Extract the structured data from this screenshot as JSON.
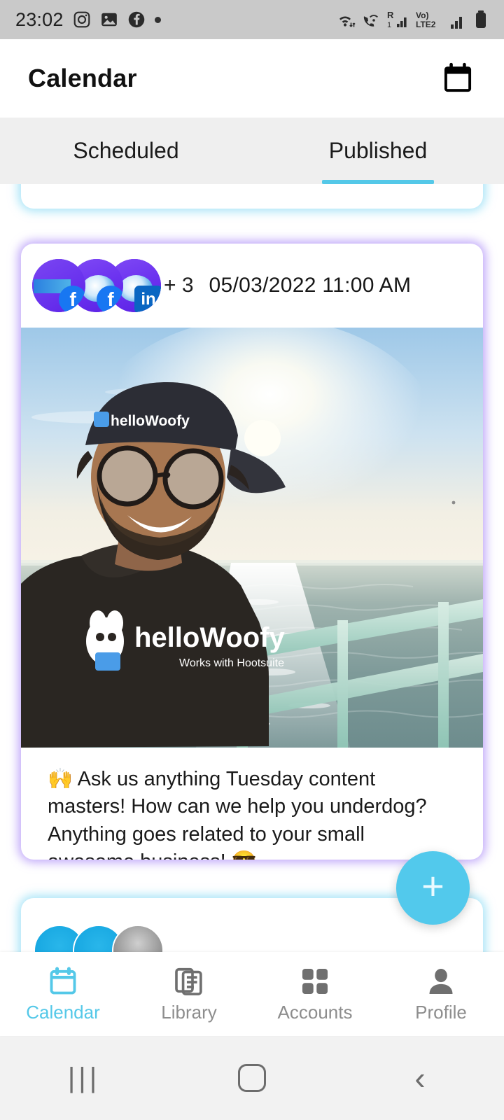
{
  "statusbar": {
    "time": "23:02",
    "left_icons": [
      "instagram-icon",
      "gallery-icon",
      "facebook-icon",
      "dot-icon"
    ],
    "right_icons": [
      "wifi-icon",
      "call-wifi-icon",
      "roaming-signal-icon",
      "volte-lte2-icon",
      "signal-icon",
      "battery-icon"
    ],
    "roaming_label": "R",
    "sim1_label": "1",
    "volte_label": "Vo)",
    "lte_label": "LTE2"
  },
  "appbar": {
    "title": "Calendar",
    "calendar_icon": "calendar-icon"
  },
  "tabs": [
    {
      "label": "Scheduled",
      "active": false
    },
    {
      "label": "Published",
      "active": true
    }
  ],
  "feed": {
    "top_partial_card": {
      "glow": "#60cef0"
    },
    "post": {
      "glow": "#966ef5",
      "date": "05/03/2022 11:00 AM",
      "extra_accounts": "+ 3",
      "accounts": [
        {
          "name": "content-avatar",
          "network": "facebook",
          "badge": "f"
        },
        {
          "name": "woofy-avatar",
          "network": "facebook",
          "badge": "f"
        },
        {
          "name": "woofy-avatar-2",
          "network": "linkedin",
          "badge": "in"
        }
      ],
      "image_alt": "selfie-on-pier-at-sunset",
      "text": "🙌 Ask us anything Tuesday content masters! How can we help you underdog? Anything goes related to your small awesome business! 😎"
    },
    "bottom_partial_card": {
      "glow": "#60cef0"
    }
  },
  "fab": {
    "label": "+",
    "name": "create-post-button",
    "color": "#52c9ec"
  },
  "bottomnav": [
    {
      "label": "Calendar",
      "icon": "calendar-icon",
      "active": true
    },
    {
      "label": "Library",
      "icon": "library-icon",
      "active": false
    },
    {
      "label": "Accounts",
      "icon": "grid-icon",
      "active": false
    },
    {
      "label": "Profile",
      "icon": "person-icon",
      "active": false
    }
  ],
  "sysnav": [
    {
      "label": "recents-button",
      "icon": "recents-icon"
    },
    {
      "label": "home-button",
      "icon": "home-icon"
    },
    {
      "label": "back-button",
      "icon": "back-icon"
    }
  ],
  "colors": {
    "accent": "#54c8e8",
    "tab_bg": "#efefef",
    "status_bg": "#c9c9c9",
    "card_glow_purple": "#966ef5",
    "card_glow_cyan": "#60cef0"
  }
}
